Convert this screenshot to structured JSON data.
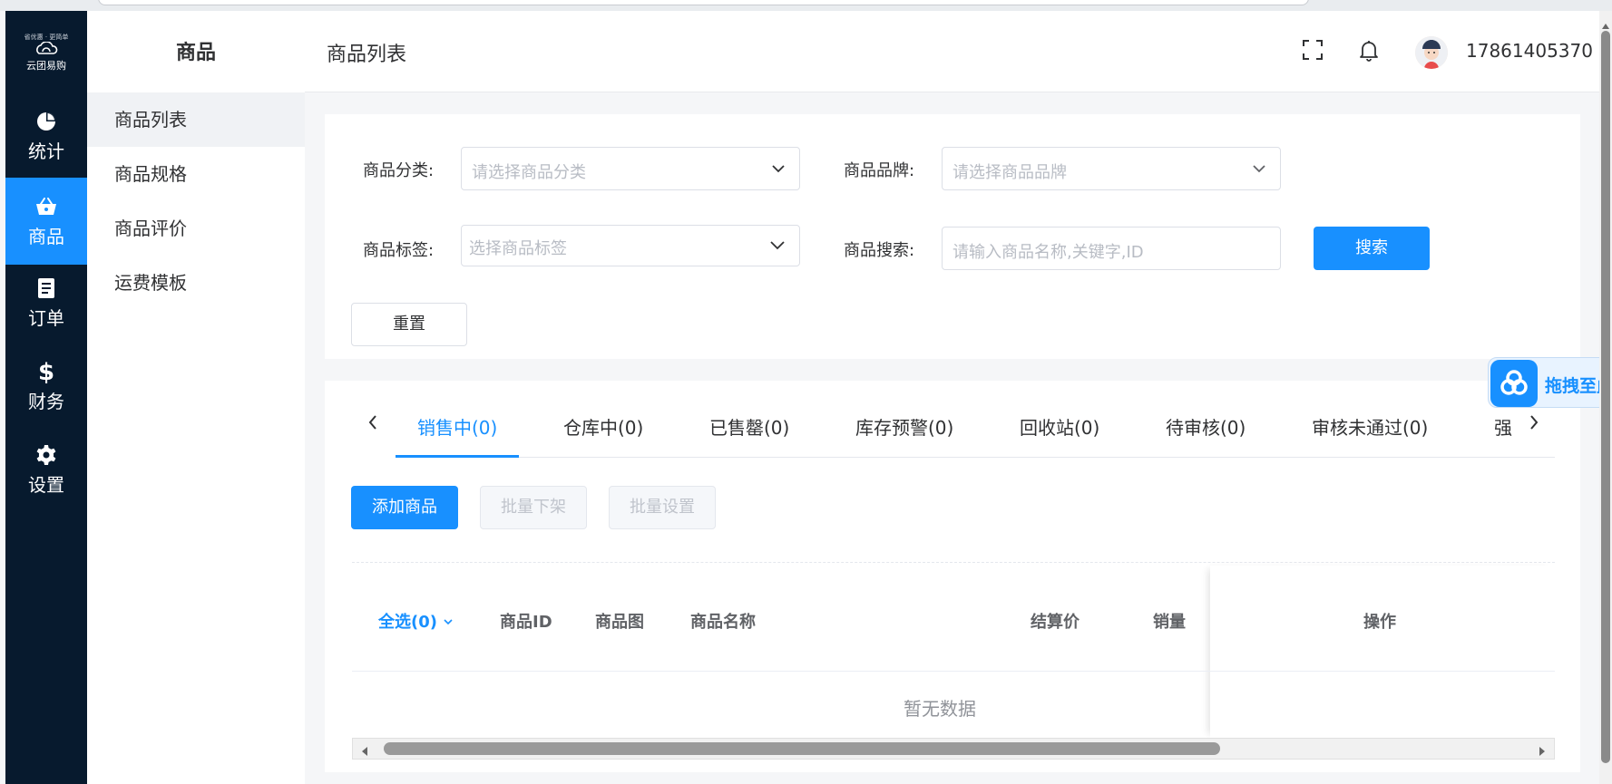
{
  "logo": {
    "tagline": "省优惠 · 更简单",
    "name": "云团易购"
  },
  "rail": {
    "items": [
      {
        "label": "统计",
        "icon": "pie-chart-icon"
      },
      {
        "label": "商品",
        "icon": "basket-icon"
      },
      {
        "label": "订单",
        "icon": "document-icon"
      },
      {
        "label": "财务",
        "icon": "dollar-icon"
      },
      {
        "label": "设置",
        "icon": "gear-icon"
      }
    ]
  },
  "subnav": {
    "title": "商品",
    "items": [
      {
        "label": "商品列表"
      },
      {
        "label": "商品规格"
      },
      {
        "label": "商品评价"
      },
      {
        "label": "运费模板"
      }
    ]
  },
  "header": {
    "title": "商品列表",
    "phone": "17861405370"
  },
  "filters": {
    "category_label": "商品分类:",
    "category_placeholder": "请选择商品分类",
    "brand_label": "商品品牌:",
    "brand_placeholder": "请选择商品品牌",
    "tag_label": "商品标签:",
    "tag_placeholder": "选择商品标签",
    "search_label": "商品搜索:",
    "search_placeholder": "请输入商品名称,关键字,ID",
    "search_button": "搜索",
    "reset_button": "重置"
  },
  "tabs": [
    {
      "label": "销售中(0)"
    },
    {
      "label": "仓库中(0)"
    },
    {
      "label": "已售罄(0)"
    },
    {
      "label": "库存预警(0)"
    },
    {
      "label": "回收站(0)"
    },
    {
      "label": "待审核(0)"
    },
    {
      "label": "审核未通过(0)"
    },
    {
      "label": "强"
    }
  ],
  "actions": {
    "add": "添加商品",
    "batch_off": "批量下架",
    "batch_set": "批量设置"
  },
  "table": {
    "headers": {
      "select_all": "全选(0)",
      "id": "商品ID",
      "image": "商品图",
      "name": "商品名称",
      "price": "结算价",
      "sales": "销量",
      "ops": "操作"
    },
    "empty": "暂无数据"
  },
  "drag_widget": {
    "label": "拖拽至此"
  },
  "colors": {
    "primary": "#1890ff",
    "rail_bg": "#071a2e"
  }
}
